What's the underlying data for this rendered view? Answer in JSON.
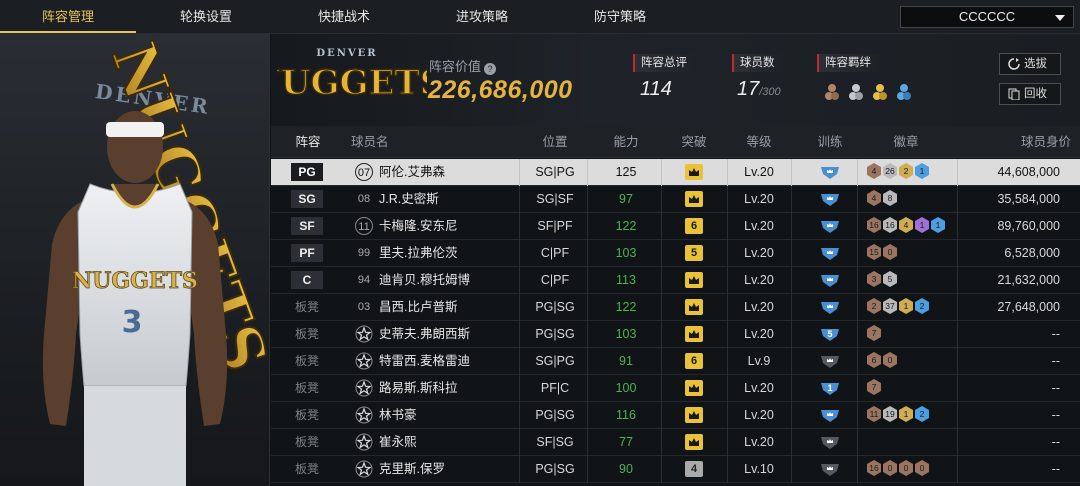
{
  "nav": {
    "tabs": [
      "阵容管理",
      "轮换设置",
      "快捷战术",
      "进攻策略",
      "防守策略"
    ],
    "active": 0
  },
  "team_select": "CCCCCC",
  "header": {
    "logo_text": "NUGGETS",
    "logo_small": "DENVER",
    "value_label": "阵容价值",
    "value": "226,686,000",
    "overall_label": "阵容总评",
    "overall": "114",
    "players_label": "球员数",
    "players": "17",
    "players_max": "/300",
    "synergy_label": "阵容羁绊",
    "btn_select": "选拔",
    "btn_recycle": "回收"
  },
  "player": {
    "jersey_team": "NUGGETS",
    "jersey_number": "3",
    "bg_text": "NUGGETS",
    "bg_small": "DENVER"
  },
  "columns": [
    "阵容",
    "球员名",
    "位置",
    "能力",
    "突破",
    "等级",
    "训练",
    "徽章",
    "球员身价"
  ],
  "rows": [
    {
      "slot": "PG",
      "starter": true,
      "num": "07",
      "mark": "circ",
      "name": "阿伦.艾弗森",
      "pos": "SG|PG",
      "ability": "125",
      "green": false,
      "breakthrough": "",
      "bgray": false,
      "level": "Lv.20",
      "train": "",
      "train_dark": false,
      "badges": [
        [
          "bronze",
          "4"
        ],
        [
          "silver",
          "26"
        ],
        [
          "gold",
          "2"
        ],
        [
          "blue",
          "1"
        ]
      ],
      "salary": "44,608,000",
      "sel": true
    },
    {
      "slot": "SG",
      "starter": true,
      "num": "08",
      "mark": "",
      "name": "J.R.史密斯",
      "pos": "SG|SF",
      "ability": "97",
      "green": true,
      "breakthrough": "",
      "bgray": false,
      "level": "Lv.20",
      "train": "",
      "train_dark": false,
      "badges": [
        [
          "bronze",
          "4"
        ],
        [
          "silver",
          "8"
        ]
      ],
      "salary": "35,584,000",
      "sel": false
    },
    {
      "slot": "SF",
      "starter": true,
      "num": "11",
      "mark": "circ",
      "name": "卡梅隆.安东尼",
      "pos": "SF|PF",
      "ability": "122",
      "green": true,
      "breakthrough": "6",
      "bgray": false,
      "level": "Lv.20",
      "train": "",
      "train_dark": false,
      "badges": [
        [
          "bronze",
          "16"
        ],
        [
          "silver",
          "16"
        ],
        [
          "gold",
          "4"
        ],
        [
          "purple",
          "1"
        ],
        [
          "blue",
          "1"
        ]
      ],
      "salary": "89,760,000",
      "sel": false
    },
    {
      "slot": "PF",
      "starter": true,
      "num": "99",
      "mark": "",
      "name": "里夫.拉弗伦茨",
      "pos": "C|PF",
      "ability": "103",
      "green": true,
      "breakthrough": "5",
      "bgray": false,
      "level": "Lv.20",
      "train": "",
      "train_dark": false,
      "badges": [
        [
          "bronze",
          "15"
        ],
        [
          "bronze",
          "0"
        ]
      ],
      "salary": "6,528,000",
      "sel": false
    },
    {
      "slot": "C",
      "starter": true,
      "num": "94",
      "mark": "",
      "name": "迪肯贝.穆托姆博",
      "pos": "C|PF",
      "ability": "113",
      "green": true,
      "breakthrough": "",
      "bgray": false,
      "level": "Lv.20",
      "train": "",
      "train_dark": false,
      "badges": [
        [
          "bronze",
          "3"
        ],
        [
          "silver",
          "5"
        ]
      ],
      "salary": "21,632,000",
      "sel": false
    },
    {
      "slot": "板凳",
      "starter": false,
      "num": "03",
      "mark": "",
      "name": "昌西.比卢普斯",
      "pos": "PG|SG",
      "ability": "122",
      "green": true,
      "breakthrough": "",
      "bgray": false,
      "level": "Lv.20",
      "train": "",
      "train_dark": false,
      "badges": [
        [
          "bronze",
          "2"
        ],
        [
          "silver",
          "37"
        ],
        [
          "gold",
          "1"
        ],
        [
          "blue",
          "2"
        ]
      ],
      "salary": "27,648,000",
      "sel": false
    },
    {
      "slot": "板凳",
      "starter": false,
      "num": "",
      "mark": "star",
      "name": "史蒂夫.弗朗西斯",
      "pos": "PG|SG",
      "ability": "103",
      "green": true,
      "breakthrough": "",
      "bgray": false,
      "level": "Lv.20",
      "train": "5",
      "train_dark": false,
      "badges": [
        [
          "bronze",
          "7"
        ]
      ],
      "salary": "--",
      "sel": false
    },
    {
      "slot": "板凳",
      "starter": false,
      "num": "",
      "mark": "star",
      "name": "特雷西.麦格雷迪",
      "pos": "SG|PG",
      "ability": "91",
      "green": true,
      "breakthrough": "6",
      "bgray": false,
      "level": "Lv.9",
      "train": "",
      "train_dark": true,
      "badges": [
        [
          "bronze",
          "6"
        ],
        [
          "bronze",
          "0"
        ]
      ],
      "salary": "--",
      "sel": false
    },
    {
      "slot": "板凳",
      "starter": false,
      "num": "",
      "mark": "star",
      "name": "路易斯.斯科拉",
      "pos": "PF|C",
      "ability": "100",
      "green": true,
      "breakthrough": "",
      "bgray": false,
      "level": "Lv.20",
      "train": "1",
      "train_dark": false,
      "badges": [
        [
          "bronze",
          "7"
        ]
      ],
      "salary": "--",
      "sel": false
    },
    {
      "slot": "板凳",
      "starter": false,
      "num": "",
      "mark": "star",
      "name": "林书豪",
      "pos": "PG|SG",
      "ability": "116",
      "green": true,
      "breakthrough": "",
      "bgray": false,
      "level": "Lv.20",
      "train": "",
      "train_dark": false,
      "badges": [
        [
          "bronze",
          "11"
        ],
        [
          "silver",
          "19"
        ],
        [
          "gold",
          "1"
        ],
        [
          "blue",
          "2"
        ]
      ],
      "salary": "--",
      "sel": false
    },
    {
      "slot": "板凳",
      "starter": false,
      "num": "",
      "mark": "star",
      "name": "崔永熙",
      "pos": "SF|SG",
      "ability": "77",
      "green": true,
      "breakthrough": "",
      "bgray": false,
      "level": "Lv.20",
      "train": "",
      "train_dark": true,
      "badges": [],
      "salary": "--",
      "sel": false
    },
    {
      "slot": "板凳",
      "starter": false,
      "num": "",
      "mark": "star",
      "name": "克里斯.保罗",
      "pos": "PG|SG",
      "ability": "90",
      "green": true,
      "breakthrough": "4",
      "bgray": true,
      "level": "Lv.10",
      "train": "",
      "train_dark": true,
      "badges": [
        [
          "bronze",
          "16"
        ],
        [
          "bronze",
          "0"
        ],
        [
          "bronze",
          "0"
        ],
        [
          "bronze",
          "0"
        ]
      ],
      "salary": "--",
      "sel": false
    }
  ],
  "colors": {
    "accent": "#e7c35a",
    "value": "#e5b33e",
    "green": "#4bb351",
    "red_mark": "#c22b2b"
  }
}
